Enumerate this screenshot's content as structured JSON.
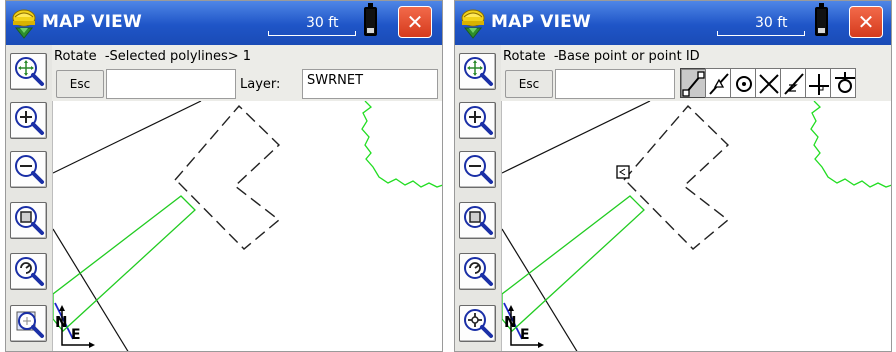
{
  "colors": {
    "title_bar": "#1f55c7",
    "close_button": "#e0432a",
    "selected_polyline": "#22cc22",
    "dashed_polyline": "#222222",
    "road_line": "#111111",
    "blue_line": "#1e28c8"
  },
  "panels": [
    {
      "app_title": "MAP VIEW",
      "scale_label": "30 ft",
      "command_text": "Rotate  -Selected polylines> 1",
      "esc_label": "Esc",
      "layer_label": "Layer:",
      "layer_value": "SWRNET",
      "north_label": "N",
      "east_label": "E",
      "tools": [
        "zoom-extents-icon",
        "zoom-in-icon",
        "zoom-out-icon",
        "zoom-window-icon",
        "zoom-previous-icon",
        "zoom-layer-icon"
      ]
    },
    {
      "app_title": "MAP VIEW",
      "scale_label": "30 ft",
      "command_text": "Rotate  -Base point or point ID",
      "esc_label": "Esc",
      "north_label": "N",
      "east_label": "E",
      "tools": [
        "zoom-extents-icon",
        "zoom-in-icon",
        "zoom-out-icon",
        "zoom-window-icon",
        "zoom-previous-icon",
        "zoom-point-icon"
      ],
      "snap_tools": [
        "snap-endpoint-icon",
        "snap-midpoint-icon",
        "snap-center-icon",
        "snap-intersection-icon",
        "snap-nearest-icon",
        "snap-perpendicular-icon",
        "snap-tangent-icon"
      ],
      "snap_active": "snap-endpoint-icon"
    }
  ]
}
